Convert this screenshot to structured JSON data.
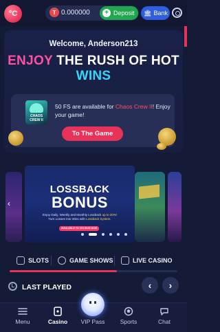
{
  "topbar": {
    "logo_text": "°C",
    "balance": "0.000000",
    "currency_icon": "coin-icon",
    "deposit_label": "Deposit",
    "bank_label": "Bank",
    "settings_icon": "gear-icon"
  },
  "hero": {
    "welcome": "Welcome, Anderson213",
    "headline_part1": "ENJOY",
    "headline_part2": "THE RUSH OF HOT",
    "headline_part3": "WINS"
  },
  "free_spins": {
    "text_prefix": "50 FS are available for",
    "game_name": "Chaos Crew II",
    "text_suffix": "! Enjoy your game!",
    "thumb_label": "CHAOS CREW II",
    "button_label": "To The Game"
  },
  "carousel": {
    "banner_line1": "LOSSBACK",
    "banner_line2": "BONUS",
    "banner_desc_part1": "Enjoy Daily, Weekly and Monthly Lossback",
    "banner_desc_hl": "up to 20%!",
    "banner_desc_part2": "Turn Losses into Wins with",
    "banner_desc_hl2": "Lossback System.",
    "banner_cta": "AVAILABLE TO CELSIUS NOW",
    "slide_count": 6,
    "active_slide": 1
  },
  "categories": {
    "items": [
      {
        "label": "SLOTS",
        "icon": "slots-icon"
      },
      {
        "label": "GAME SHOWS",
        "icon": "game-shows-icon"
      },
      {
        "label": "LIVE CASINO",
        "icon": "live-casino-icon"
      }
    ]
  },
  "last_played": {
    "title": "LAST PLAYED",
    "prev_label": "‹",
    "next_label": "›"
  },
  "bottom_nav": {
    "items": [
      {
        "label": "Menu",
        "icon": "menu-icon",
        "active": false
      },
      {
        "label": "Casino",
        "icon": "casino-icon",
        "active": true
      },
      {
        "label": "VIP Pass",
        "icon": "vip-ghost-icon",
        "active": false
      },
      {
        "label": "Sports",
        "icon": "sports-icon",
        "active": false
      },
      {
        "label": "Chat",
        "icon": "chat-icon",
        "active": false
      }
    ]
  },
  "colors": {
    "background": "#141b37",
    "accent_red": "#e8325a",
    "deposit_green": "#1fa84f",
    "bank_blue": "#2f5fe0",
    "headline_pink": "#ff4fa3",
    "headline_cyan": "#38d3ff"
  }
}
